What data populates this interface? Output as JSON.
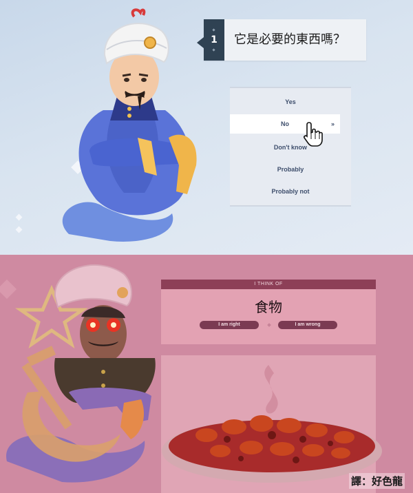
{
  "question": {
    "number": "1",
    "text": "它是必要的東西嗎？"
  },
  "answers": [
    {
      "label": "Yes",
      "selected": false
    },
    {
      "label": "No",
      "selected": true
    },
    {
      "label": "Don't know",
      "selected": false
    },
    {
      "label": "Probably",
      "selected": false
    },
    {
      "label": "Probably not",
      "selected": false
    }
  ],
  "selected_chevron": "»",
  "result": {
    "header": "I THINK OF",
    "answer": "食物",
    "right_button": "I am right",
    "wrong_button": "I am wrong"
  },
  "credit": "譯：好色龍",
  "colors": {
    "top_background": "#d9e4f0",
    "question_number_bg": "#2f4253",
    "answer_text": "#3e4e6c",
    "bottom_tint": "#cf8aa1",
    "result_header_bg": "#8d3f57"
  },
  "icons": [
    "genie",
    "hand-cursor-icon",
    "hammer-sickle-icon",
    "star-icon",
    "steam-icon",
    "sparkle-icon"
  ]
}
